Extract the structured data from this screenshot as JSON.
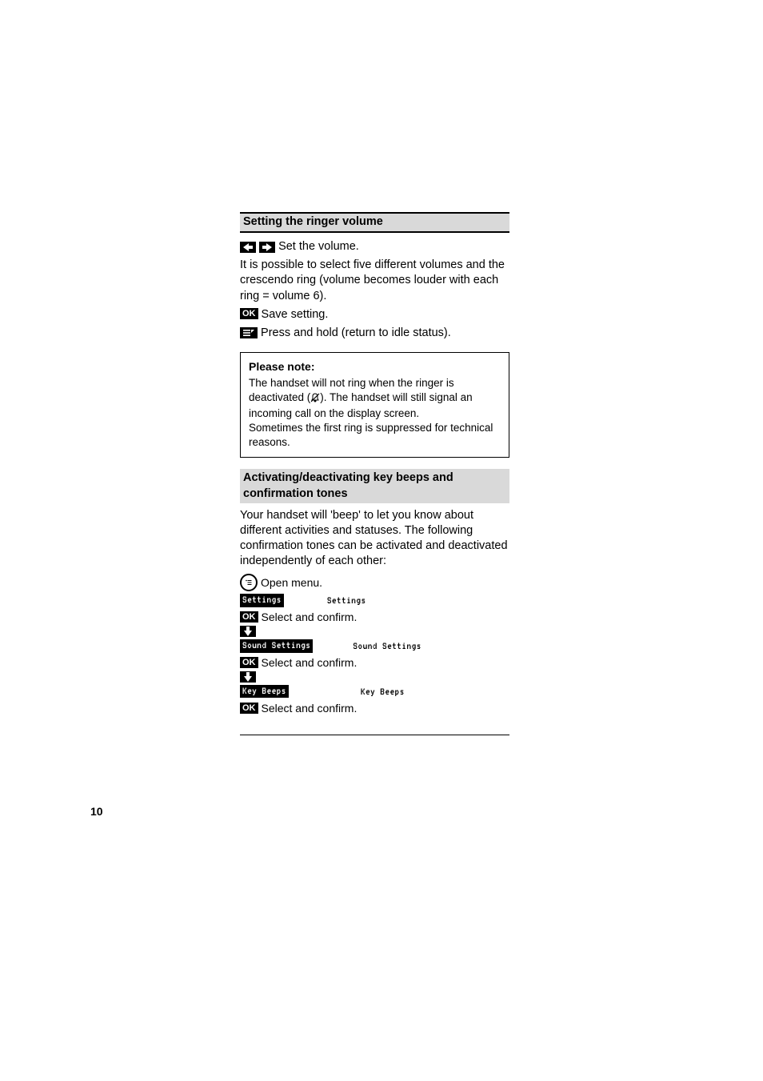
{
  "page": {
    "number": "10"
  },
  "section": {
    "h2": "Setting the ringer volume",
    "p1_before": "",
    "p1_after": " Set the volume.",
    "p2": "It is possible to select five different volumes and the crescendo ring (volume becomes louder with each ring = volume 6).",
    "p3_prefix": "",
    "p3_save": " Save setting.",
    "p4_prefix": "",
    "p4_tail": " Press and hold (return to idle status)."
  },
  "note": {
    "title": "Please note:",
    "line1_before": "The handset will not ring when the ringer is deactivated (",
    "line1_after": "). The handset will still signal an incoming call on the display screen.",
    "line2": "Sometimes the first ring is suppressed for technical reasons."
  },
  "h3": "Activating/deactivating key beeps and confirmation tones",
  "body2": {
    "p1": "Your handset will 'beep' to let you know about different activities and statuses. The following confirmation tones can be activated and deactivated independently of each other:"
  },
  "menu": {
    "open_menu_text": " Open menu.",
    "settings_inverse": "Settings",
    "settings_plain": "Settings",
    "select_confirm": " Select and confirm.",
    "sound_inverse": "Sound Settings",
    "sound_plain": "Sound Settings",
    "keybeeps_inverse": "Key Beeps",
    "keybeeps_plain": "Key Beeps"
  }
}
